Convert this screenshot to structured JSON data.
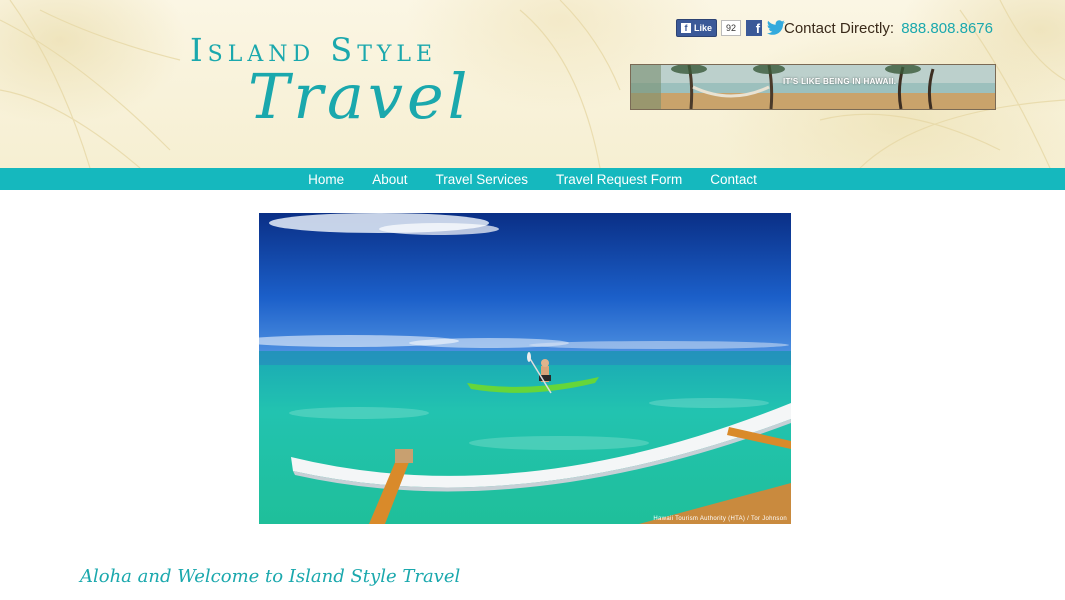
{
  "logo": {
    "line1": "Island Style",
    "line2": "Travel"
  },
  "social": {
    "like_label": "Like",
    "like_count": "92",
    "facebook_icon": "facebook-icon",
    "twitter_icon": "twitter-icon"
  },
  "contact": {
    "label": "Contact Directly:",
    "phone": "888.808.8676"
  },
  "banner": {
    "text": "IT'S LIKE BEING IN HAWAII."
  },
  "nav": {
    "items": [
      {
        "label": "Home"
      },
      {
        "label": "About"
      },
      {
        "label": "Travel Services"
      },
      {
        "label": "Travel Request Form"
      },
      {
        "label": "Contact"
      }
    ]
  },
  "hero": {
    "credit": "Hawaii Tourism Authority (HTA) / Tor Johnson"
  },
  "main": {
    "welcome_heading": "Aloha and Welcome to Island Style Travel"
  },
  "colors": {
    "brand_teal": "#1aa8ad",
    "nav_background": "#15b8be",
    "header_cream": "#f6efd2"
  }
}
